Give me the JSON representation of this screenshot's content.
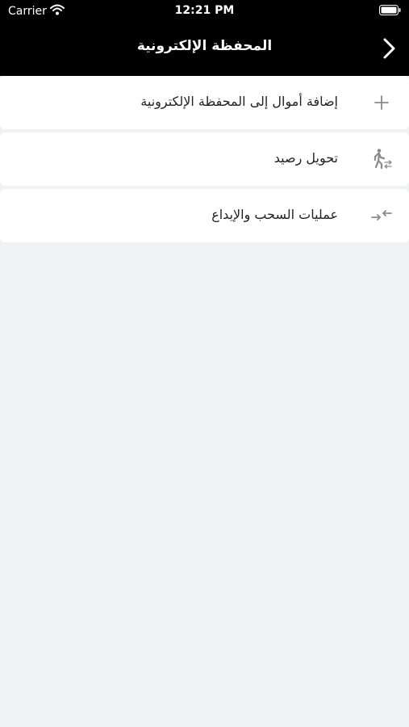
{
  "status_bar": {
    "carrier": "Carrier",
    "time": "12:21 PM"
  },
  "nav": {
    "title": "المحفظة الإلكترونية"
  },
  "menu": {
    "items": [
      {
        "label": "إضافة أموال إلى المحفظة الإلكترونية",
        "icon": "plus-icon"
      },
      {
        "label": "تحويل رصيد",
        "icon": "person-transfer-icon"
      },
      {
        "label": "عمليات السحب والإيداع",
        "icon": "arrows-exchange-icon"
      }
    ]
  },
  "colors": {
    "header_bg": "#000000",
    "page_bg": "#f0f1f3",
    "card_bg": "#ffffff",
    "icon_gray": "#8a8a8a"
  }
}
